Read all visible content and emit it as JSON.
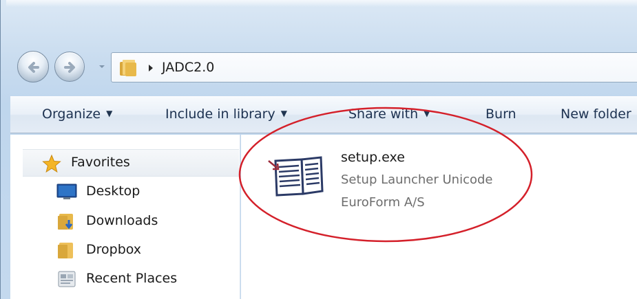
{
  "address": {
    "crumbs": [
      "JADC2.0"
    ]
  },
  "toolbar": {
    "organize_label": "Organize",
    "include_label": "Include in library",
    "share_label": "Share with",
    "burn_label": "Burn",
    "newfolder_label": "New folder"
  },
  "sidebar": {
    "favorites_label": "Favorites",
    "items": [
      {
        "label": "Desktop",
        "icon": "desktop-icon"
      },
      {
        "label": "Downloads",
        "icon": "downloads-folder-icon"
      },
      {
        "label": "Dropbox",
        "icon": "folder-icon"
      },
      {
        "label": "Recent Places",
        "icon": "recent-places-icon"
      }
    ]
  },
  "files": [
    {
      "name": "setup.exe",
      "description": "Setup Launcher Unicode",
      "company": "EuroForm A/S",
      "icon": "setup-installer-icon"
    }
  ],
  "colors": {
    "highlight": "#d4202a",
    "command_text": "#1c3150",
    "secondary_text": "#6d6d6d"
  }
}
